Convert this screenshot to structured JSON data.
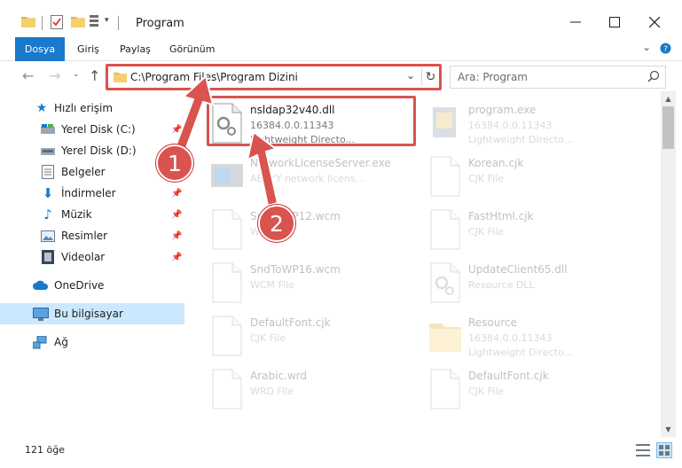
{
  "window": {
    "title": "Program"
  },
  "ribbon": {
    "tabs": [
      "Dosya",
      "Giriş",
      "Paylaş",
      "Görünüm"
    ]
  },
  "address": {
    "path": "C:\\Program Files\\Program Dizini"
  },
  "search": {
    "placeholder": "Ara: Program"
  },
  "sidebar": {
    "items": [
      {
        "label": "Hızlı erişim",
        "icon": "star-icon"
      },
      {
        "label": "Yerel Disk (C:)",
        "icon": "drive-icon"
      },
      {
        "label": "Yerel Disk (D:)",
        "icon": "drive-icon"
      },
      {
        "label": "Belgeler",
        "icon": "documents-icon"
      },
      {
        "label": "İndirmeler",
        "icon": "download-icon"
      },
      {
        "label": "Müzik",
        "icon": "music-icon"
      },
      {
        "label": "Resimler",
        "icon": "pictures-icon"
      },
      {
        "label": "Videolar",
        "icon": "video-icon"
      },
      {
        "label": "OneDrive",
        "icon": "cloud-icon"
      },
      {
        "label": "Bu bilgisayar",
        "icon": "computer-icon"
      },
      {
        "label": "Ağ",
        "icon": "network-icon"
      }
    ]
  },
  "files": [
    {
      "name": "nsldap32v40.dll",
      "line1": "16384.0.0.11343",
      "line2": "Lightweight Directo...",
      "icon": "dll-icon"
    },
    {
      "name": "program.exe",
      "line1": "16384.0.0.11343",
      "line2": "Lightweight Directo...",
      "icon": "exe-icon"
    },
    {
      "name": "NetworkLicenseServer.exe",
      "line1": "ABBYY network licens...",
      "line2": "",
      "icon": "app-icon"
    },
    {
      "name": "Korean.cjk",
      "line1": "CJK File",
      "line2": "",
      "icon": "file-icon"
    },
    {
      "name": "SndToWP12.wcm",
      "line1": "WCM File",
      "line2": "",
      "icon": "file-icon"
    },
    {
      "name": "FastHtml.cjk",
      "line1": "CJK File",
      "line2": "",
      "icon": "file-icon"
    },
    {
      "name": "SndToWP16.wcm",
      "line1": "WCM File",
      "line2": "",
      "icon": "file-icon"
    },
    {
      "name": "UpdateClient65.dll",
      "line1": "Resource DLL",
      "line2": "",
      "icon": "dll-icon"
    },
    {
      "name": "DefaultFont.cjk",
      "line1": "CJK File",
      "line2": "",
      "icon": "file-icon"
    },
    {
      "name": "Resource",
      "line1": "16384.0.0.11343",
      "line2": "Lightweight Directo...",
      "icon": "folder-icon"
    },
    {
      "name": "Arabic.wrd",
      "line1": "WRD File",
      "line2": "",
      "icon": "file-icon"
    },
    {
      "name": "DefaultFont.cjk",
      "line1": "CJK File",
      "line2": "",
      "icon": "file-icon"
    }
  ],
  "status": {
    "count": "121 öğe"
  },
  "callouts": [
    "1",
    "2"
  ],
  "colors": {
    "accent": "#1979ca",
    "annotation": "#d9534f",
    "selected": "#cce8ff"
  }
}
